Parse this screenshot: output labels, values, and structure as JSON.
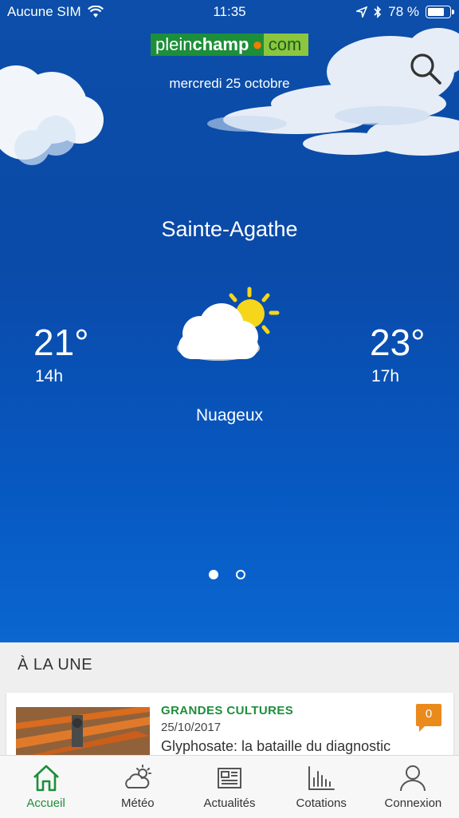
{
  "status": {
    "carrier": "Aucune SIM",
    "time": "11:35",
    "battery": "78 %",
    "battery_level": 0.78
  },
  "header": {
    "logo_part1": "plein",
    "logo_part1_bold": "champ",
    "logo_part2": "com",
    "date": "mercredi 25 octobre"
  },
  "weather": {
    "city": "Sainte-Agathe",
    "left_temp": "21°",
    "left_hour": "14h",
    "right_temp": "23°",
    "right_hour": "17h",
    "condition": "Nuageux",
    "icon": "partly-cloudy-icon",
    "page_count": 2,
    "current_page": 1
  },
  "news": {
    "section_title": "À LA UNE",
    "items": [
      {
        "category": "GRANDES CULTURES",
        "date": "25/10/2017",
        "headline": "Glyphosate: la bataille du diagnostic",
        "comments": "0"
      }
    ]
  },
  "tabs": [
    {
      "label": "Accueil",
      "icon": "home-icon",
      "active": true
    },
    {
      "label": "Météo",
      "icon": "weather-icon",
      "active": false
    },
    {
      "label": "Actualités",
      "icon": "newspaper-icon",
      "active": false
    },
    {
      "label": "Cotations",
      "icon": "chart-icon",
      "active": false
    },
    {
      "label": "Connexion",
      "icon": "user-icon",
      "active": false
    }
  ],
  "colors": {
    "brand_green": "#1d8e3a",
    "brand_light_green": "#8cc63f",
    "accent_orange": "#ea8a1d",
    "sky_blue": "#0a4aa8"
  }
}
